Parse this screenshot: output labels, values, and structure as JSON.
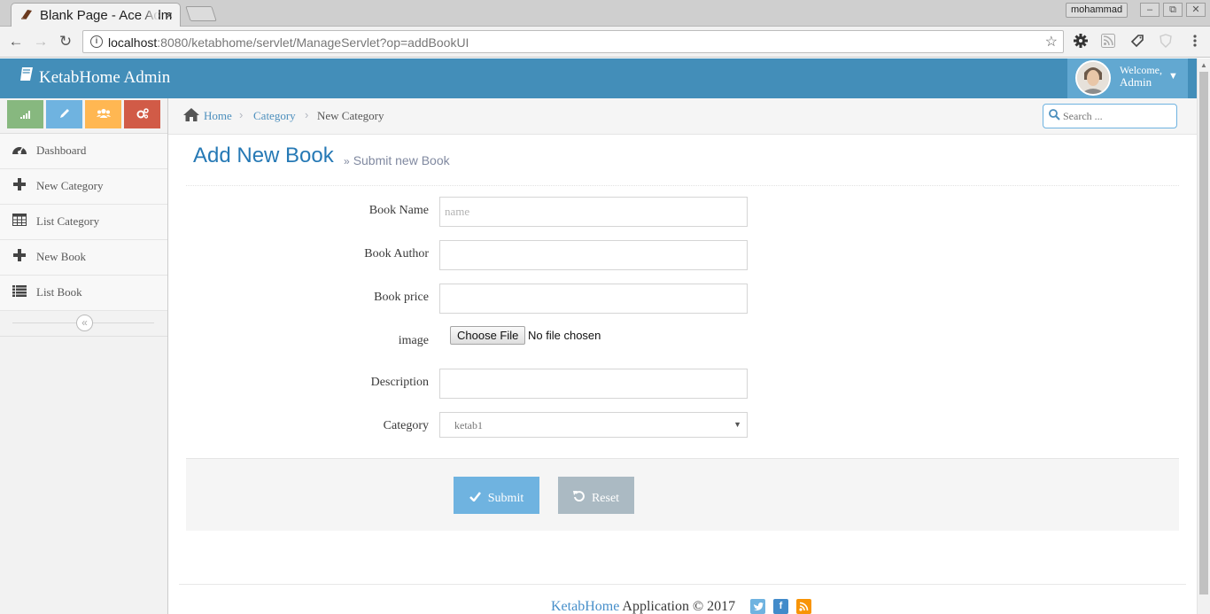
{
  "browser": {
    "tab_title": "Blank Page - Ace Admin",
    "tab_close": "×",
    "profile_name": "mohammad",
    "window_minimize": "–",
    "window_restore": "⧉",
    "window_close": "✕",
    "back": "←",
    "forward": "→",
    "reload": "↻",
    "info_icon": "i",
    "url_host": "localhost",
    "url_rest": ":8080/ketabhome/servlet/ManageServlet?op=addBookUI",
    "bookmark_star": "☆"
  },
  "navbar": {
    "brand": "KetabHome Admin",
    "welcome": "Welcome,",
    "username": "Admin"
  },
  "sidebar": {
    "shortcut_colors": [
      "#87b87f",
      "#6fb3e0",
      "#ffb752",
      "#d15b47"
    ],
    "items": [
      {
        "label": "Dashboard",
        "icon": "tachometer-icon"
      },
      {
        "label": "New Category",
        "icon": "plus-icon"
      },
      {
        "label": "List Category",
        "icon": "table-icon"
      },
      {
        "label": "New Book",
        "icon": "plus-icon"
      },
      {
        "label": "List Book",
        "icon": "list-icon"
      }
    ],
    "collapse_icon": "«"
  },
  "breadcrumbs": {
    "items": [
      "Home",
      "Category",
      "New Category"
    ],
    "search_placeholder": "Search ..."
  },
  "page": {
    "title": "Add New Book",
    "subtitle": "Submit new Book"
  },
  "form": {
    "book_name_label": "Book Name",
    "book_name_placeholder": "name",
    "book_author_label": "Book Author",
    "book_price_label": "Book price",
    "image_label": "image",
    "choose_file": "Choose File",
    "no_file": "No file chosen",
    "description_label": "Description",
    "category_label": "Category",
    "category_selected": "ketab1",
    "submit": "Submit",
    "reset": "Reset"
  },
  "footer": {
    "brand": "KetabHome",
    "text": " Application © 2017",
    "social": [
      {
        "name": "twitter-icon",
        "color": "#6fb3e0"
      },
      {
        "name": "facebook-icon",
        "color": "#428bca"
      },
      {
        "name": "rss-icon",
        "color": "#f89406"
      }
    ]
  }
}
